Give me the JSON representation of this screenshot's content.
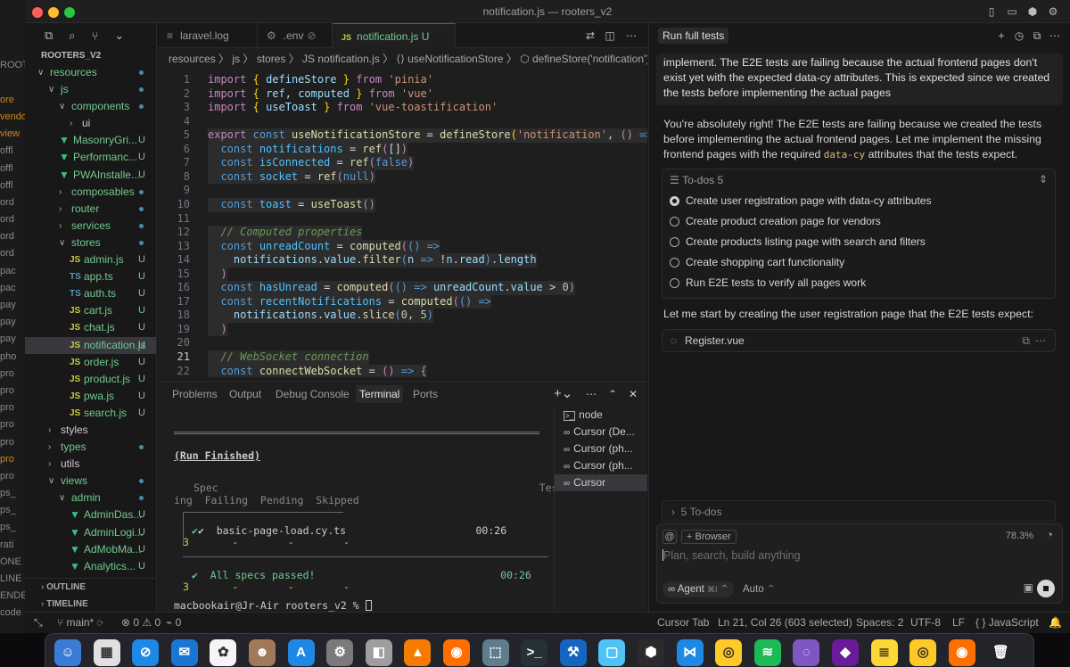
{
  "window": {
    "title": "notification.js — rooters_v2"
  },
  "behind_window": {
    "items": [
      "",
      "",
      "ROOTERS_",
      "",
      "ore",
      "vendo",
      "view",
      "offl",
      "offl",
      "offl",
      "ord",
      "ord",
      "ord",
      "ord",
      "pac",
      "pac",
      "pay",
      "pay",
      "pay",
      "pho",
      "pro",
      "pro",
      "pro",
      "pro",
      "pro",
      "pro",
      "pro",
      "ps_",
      "ps_",
      "ps_",
      "rati",
      "ONE",
      "LINE",
      "ENDEN",
      "code"
    ]
  },
  "sidebar": {
    "section_title": "ROOTERS_V2",
    "tree": [
      {
        "label": "resources",
        "chev": "∨",
        "dot": true
      },
      {
        "label": "js",
        "chev": "∨",
        "dot": true
      },
      {
        "label": "components",
        "chev": "∨",
        "dot": true
      },
      {
        "label": "ui",
        "chev": "›"
      },
      {
        "label": "MasonryGri...",
        "icon": "V",
        "status": "U"
      },
      {
        "label": "Performanc...",
        "icon": "V",
        "status": "U"
      },
      {
        "label": "PWAInstalle...",
        "icon": "V",
        "status": "U"
      },
      {
        "label": "composables",
        "chev": "›",
        "dot": true
      },
      {
        "label": "router",
        "chev": "›",
        "dot": true
      },
      {
        "label": "services",
        "chev": "›",
        "dot": true
      },
      {
        "label": "stores",
        "chev": "∨",
        "dot": true
      },
      {
        "label": "admin.js",
        "icon": "JS",
        "status": "U"
      },
      {
        "label": "app.ts",
        "icon": "TS",
        "status": "U"
      },
      {
        "label": "auth.ts",
        "icon": "TS",
        "status": "U"
      },
      {
        "label": "cart.js",
        "icon": "JS",
        "status": "U"
      },
      {
        "label": "chat.js",
        "icon": "JS",
        "status": "U"
      },
      {
        "label": "notification.js",
        "icon": "JS",
        "status": "U",
        "selected": true
      },
      {
        "label": "order.js",
        "icon": "JS",
        "status": "U"
      },
      {
        "label": "product.js",
        "icon": "JS",
        "status": "U"
      },
      {
        "label": "pwa.js",
        "icon": "JS",
        "status": "U"
      },
      {
        "label": "search.js",
        "icon": "JS",
        "status": "U"
      },
      {
        "label": "styles",
        "chev": "›"
      },
      {
        "label": "types",
        "chev": "›",
        "dot": true
      },
      {
        "label": "utils",
        "chev": "›"
      },
      {
        "label": "views",
        "chev": "∨",
        "dot": true
      },
      {
        "label": "admin",
        "chev": "∨",
        "dot": true
      },
      {
        "label": "AdminDas...",
        "icon": "V",
        "status": "U"
      },
      {
        "label": "AdminLogi...",
        "icon": "V",
        "status": "U"
      },
      {
        "label": "AdMobMa...",
        "icon": "V",
        "status": "U"
      },
      {
        "label": "Analytics...",
        "icon": "V",
        "status": "U"
      }
    ],
    "outline_label": "OUTLINE",
    "timeline_label": "TIMELINE"
  },
  "editor": {
    "tabs": [
      {
        "label": "laravel.log",
        "icon": "≡"
      },
      {
        "label": ".env",
        "icon": "⚙",
        "suffix": "⊘"
      },
      {
        "label": "notification.js U",
        "icon": "JS",
        "active": true
      }
    ],
    "breadcrumb": "resources 〉 js 〉 stores 〉 JS notification.js 〉 ⟨⟩ useNotificationStore 〉 ⬡ defineStore('notification') c",
    "current_line": 21,
    "code": [
      {
        "n": "1",
        "html": "<span class='kw'>import</span> <span class='brk'>{</span> <span class='var'>defineStore</span> <span class='brk'>}</span> <span class='kw'>from</span> <span class='str'>'pinia'</span>"
      },
      {
        "n": "2",
        "html": "<span class='kw'>import</span> <span class='brk'>{</span> <span class='var'>ref</span>, <span class='var'>computed</span> <span class='brk'>}</span> <span class='kw'>from</span> <span class='str'>'vue'</span>"
      },
      {
        "n": "3",
        "html": "<span class='kw'>import</span> <span class='brk'>{</span> <span class='var'>useToast</span> <span class='brk'>}</span> <span class='kw'>from</span> <span class='str'>'vue-toastification'</span>"
      },
      {
        "n": "4",
        "html": ""
      },
      {
        "n": "5",
        "html": "<span class='kw'>export</span> <span class='kw2'>const</span> <span class='fn'>useNotificationStore</span> = <span class='fn'>defineStore</span><span class='brk'>(</span><span class='str'>'notification'</span>, <span class='kw'>()</span> <span class='kw2'>=&gt;</span> <span class='kw'>{</span>"
      },
      {
        "n": "6",
        "html": "  <span class='kw2'>const</span> <span class='cst'>notifications</span> = <span class='fn'>ref</span><span class='kw'>(</span>[]<span class='kw'>)</span>"
      },
      {
        "n": "7",
        "html": "  <span class='kw2'>const</span> <span class='cst'>isConnected</span> = <span class='fn'>ref</span><span class='kw'>(</span><span class='kw2'>false</span><span class='kw'>)</span>"
      },
      {
        "n": "8",
        "html": "  <span class='kw2'>const</span> <span class='cst'>socket</span> = <span class='fn'>ref</span><span class='kw'>(</span><span class='kw2'>null</span><span class='kw'>)</span>"
      },
      {
        "n": "9",
        "html": ""
      },
      {
        "n": "10",
        "html": "  <span class='kw2'>const</span> <span class='cst'>toast</span> = <span class='fn'>useToast</span><span class='kw'>()</span>"
      },
      {
        "n": "11",
        "html": ""
      },
      {
        "n": "12",
        "html": "  <span class='cmt'>// Computed properties</span>"
      },
      {
        "n": "13",
        "html": "  <span class='kw2'>const</span> <span class='cst'>unreadCount</span> = <span class='fn'>computed</span><span class='kw'>(</span><span class='kw2'>()</span> <span class='kw2'>=&gt;</span>"
      },
      {
        "n": "14",
        "html": "    <span class='var'>notifications</span>.<span class='var'>value</span>.<span class='fn'>filter</span><span class='kw2'>(</span><span class='var'>n</span> <span class='kw2'>=&gt;</span> !<span class='var'>n</span>.<span class='var'>read</span><span class='kw2'>)</span>.<span class='var'>length</span>"
      },
      {
        "n": "15",
        "html": "  <span class='kw'>)</span>"
      },
      {
        "n": "16",
        "html": "  <span class='kw2'>const</span> <span class='cst'>hasUnread</span> = <span class='fn'>computed</span><span class='kw'>(</span><span class='kw2'>()</span> <span class='kw2'>=&gt;</span> <span class='var'>unreadCount</span>.<span class='var'>value</span> &gt; <span class='num'>0</span><span class='kw'>)</span>"
      },
      {
        "n": "17",
        "html": "  <span class='kw2'>const</span> <span class='cst'>recentNotifications</span> = <span class='fn'>computed</span><span class='kw'>(</span><span class='kw2'>()</span> <span class='kw2'>=&gt;</span>"
      },
      {
        "n": "18",
        "html": "    <span class='var'>notifications</span>.<span class='var'>value</span>.<span class='fn'>slice</span><span class='kw2'>(</span><span class='num'>0</span>, <span class='num'>5</span><span class='kw2'>)</span>"
      },
      {
        "n": "19",
        "html": "  <span class='kw'>)</span>"
      },
      {
        "n": "20",
        "html": ""
      },
      {
        "n": "21",
        "html": "  <span class='cmt'>// WebSocket connection</span>"
      },
      {
        "n": "22",
        "html": "  <span class='kw2'>const</span> <span class='fn'>connectWebSocket</span> = <span class='kw'>()</span> <span class='kw2'>=&gt;</span> <span class='kw'>{</span>"
      }
    ]
  },
  "panel": {
    "tabs": [
      "Problems",
      "Output",
      "Debug Console",
      "Terminal",
      "Ports"
    ],
    "active_tab": "Terminal",
    "terminal_lines": [
      "(Run Finished)",
      "Spec                                                    Tests  Pass",
      "ing  Failing  Pending  Skipped",
      "✔  basic-page-load.cy.ts                     00:26        3",
      "3       -        -        -",
      "✔  All specs passed!                              00:26        3",
      "3       -        -        -",
      "macbookair@Jr-Air rooters_v2 % "
    ],
    "terminal_list": [
      {
        "label": "node",
        "icon": ">_"
      },
      {
        "label": "Cursor (De...",
        "icon": "∞"
      },
      {
        "label": "Cursor (ph...",
        "icon": "∞"
      },
      {
        "label": "Cursor (ph...",
        "icon": "∞"
      },
      {
        "label": "Cursor",
        "icon": "∞",
        "selected": true
      }
    ]
  },
  "chat": {
    "title": "Run full tests",
    "user_message": "implement. The E2E tests are failing because the actual frontend pages don't exist yet with the expected data-cy attributes. This is expected since we created the tests before implementing the actual pages",
    "reply_part1": "You're absolutely right! The E2E tests are failing because we created the tests before implementing the actual frontend pages. Let me implement the missing frontend pages with the required ",
    "reply_code": "data-cy",
    "reply_part2": " attributes that the tests expect.",
    "todos_header": "To-dos",
    "todos_count": "5",
    "todos": [
      {
        "label": "Create user registration page with data-cy attributes",
        "active": true
      },
      {
        "label": "Create product creation page for vendors",
        "active": false
      },
      {
        "label": "Create products listing page with search and filters",
        "active": false
      },
      {
        "label": "Create shopping cart functionality",
        "active": false
      },
      {
        "label": "Run E2E tests to verify all pages work",
        "active": false
      }
    ],
    "followup": "Let me start by creating the user registration page that the E2E tests expect:",
    "file_chip": "Register.vue",
    "collapsed_todos": "5 To-dos",
    "input_placeholder": "Plan, search, build anything",
    "at_label": "@",
    "browser_label": "Browser",
    "context_percent": "78.3%",
    "agent_label": "Agent",
    "agent_shortcut": "⌘I",
    "model_label": "Auto"
  },
  "statusbar": {
    "branch": "main*",
    "errors": "0",
    "warnings": "0",
    "ports": "0",
    "cursor_tab": "Cursor Tab",
    "position": "Ln 21, Col 26 (603 selected)",
    "spaces": "Spaces: 2",
    "encoding": "UTF-8",
    "eol": "LF",
    "language": "JavaScript"
  },
  "dock": {
    "apps": [
      "finder-icon",
      "launchpad-icon",
      "safari-icon",
      "mail-icon",
      "photos-icon",
      "contacts-icon",
      "app-store-icon",
      "settings-icon",
      "preview-icon",
      "vlc-icon",
      "firefox-icon",
      "screenshot-icon",
      "terminal-icon",
      "xcode-icon",
      "simulator-icon",
      "cursor-app-icon",
      "vscode-icon",
      "chrome-icon",
      "spotify-icon",
      "tor-icon",
      "app-icon",
      "notes-icon",
      "chrome-icon",
      "firefox-icon",
      "trash-icon"
    ]
  },
  "colors": {
    "accent": "#0078d4",
    "untracked": "#73c991",
    "vue": "#42b883",
    "js": "#cbcb41",
    "ts": "#519aba"
  }
}
